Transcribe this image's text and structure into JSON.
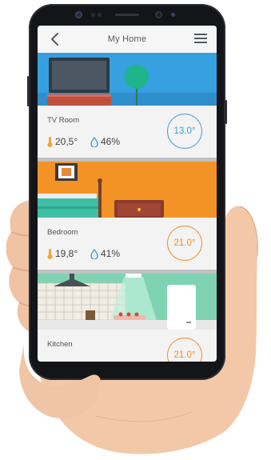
{
  "header": {
    "title": "My Home"
  },
  "rooms": [
    {
      "name": "TV Room",
      "temperature": "20,5°",
      "humidity": "46%",
      "setpoint": "13.0°",
      "setpoint_color": "#3a9bd5",
      "illustration_bg": "#36a0e0"
    },
    {
      "name": "Bedroom",
      "temperature": "19,8°",
      "humidity": "41%",
      "setpoint": "21.0°",
      "setpoint_color": "#f08a1c",
      "illustration_bg": "#f39325"
    },
    {
      "name": "Kitchen",
      "temperature": "",
      "humidity": "",
      "setpoint": "21.0°",
      "setpoint_color": "#f08a1c",
      "illustration_bg": "#7fd3b2"
    }
  ],
  "icons": {
    "back": "chevron-left-icon",
    "menu": "hamburger-menu-icon",
    "temperature": "thermometer-icon",
    "humidity": "water-drop-icon"
  },
  "colors": {
    "temperature_icon": "#f0a43a",
    "humidity_icon": "#3a9bd5"
  }
}
